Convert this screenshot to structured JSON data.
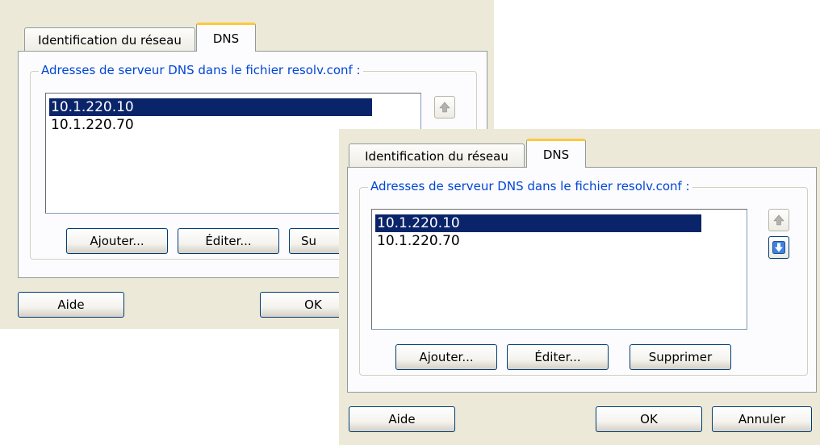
{
  "tabs": {
    "network_id": "Identification du réseau",
    "dns": "DNS"
  },
  "group": {
    "legend": "Adresses de serveur DNS dans le fichier resolv.conf :"
  },
  "dns_servers": [
    "10.1.220.10",
    "10.1.220.70"
  ],
  "buttons": {
    "add": "Ajouter...",
    "edit": "Éditer...",
    "delete": "Supprimer",
    "delete_partial": "Su",
    "help": "Aide",
    "ok": "OK",
    "cancel": "Annuler"
  },
  "icons": {
    "move_up": "arrow-up-icon",
    "move_down": "arrow-down-icon"
  },
  "colors": {
    "dialog_bg": "#ece9d8",
    "selection": "#0a246a",
    "legend_text": "#0046d5",
    "active_tab_accent": "#ffc83c",
    "arrow_enabled": "#2a6fd6"
  }
}
